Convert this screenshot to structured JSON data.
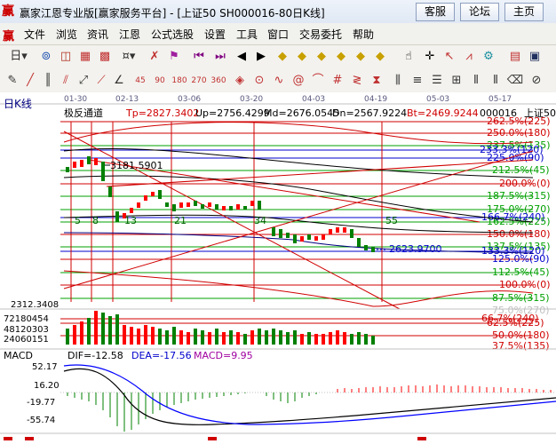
{
  "window": {
    "title": "赢家江恩专业版[赢家服务平台] - [上证50  SH000016-80日K线]",
    "buttons": [
      "客服",
      "论坛",
      "主页"
    ]
  },
  "menu": {
    "items": [
      "文件",
      "浏览",
      "资讯",
      "江恩",
      "公式选股",
      "设置",
      "工具",
      "窗口",
      "交易委托",
      "帮助"
    ]
  },
  "chart": {
    "period_label": "日K线",
    "indicator_name": "极反通道",
    "tp": "Tp=2827.3402",
    "up": "Up=2756.4299",
    "md": "Md=2676.0545",
    "dn": "Dn=2567.9224",
    "bt": "Bt=2469.9244",
    "symbol": "000016",
    "symbol_name": "上证50",
    "date_ticks": [
      "01-30",
      "02-13",
      "03-06",
      "03-20",
      "04-03",
      "04-19",
      "05-03",
      "05-17"
    ],
    "price_callout_high": "3181.5901",
    "price_callout_low": "2623.9700",
    "price_low_label": "2312.3408",
    "count_labels": [
      "5",
      "8",
      "13",
      "21",
      "34",
      "55"
    ],
    "gann_levels": [
      "262.5%(225)",
      "250.0%(180)",
      "237.5%(135)",
      "233.3%(120)",
      "225.0%(90)",
      "212.5%(45)",
      "200.0%(0)",
      "187.5%(315)",
      "175.0%(270)",
      "166.7%(240)",
      "162.5%(225)",
      "150.0%(180)",
      "137.5%(135)",
      "133.3%(120)",
      "125.0%(90)",
      "112.5%(45)",
      "100.0%(0)",
      "87.5%(315)",
      "75.0%(270)",
      "66.7%(240)",
      "62.5%(225)",
      "50.0%(180)",
      "37.5%(135)"
    ],
    "volume_labels": [
      "72180454",
      "48120303",
      "24060151"
    ],
    "macd": {
      "name": "MACD",
      "dif": "DIF=-12.58",
      "dea": "DEA=-17.56",
      "macd": "MACD=9.95",
      "y_labels": [
        "52.17",
        "16.20",
        "-19.77",
        "-55.74"
      ]
    },
    "colors": {
      "background": "#ffffff",
      "up_candle": "#ff0000",
      "down_candle": "#008000",
      "gann_green": "#00a000",
      "gann_red": "#d00000",
      "gann_blue": "#0000cc",
      "dif_line": "#000000",
      "dea_line": "#0000ff"
    }
  }
}
